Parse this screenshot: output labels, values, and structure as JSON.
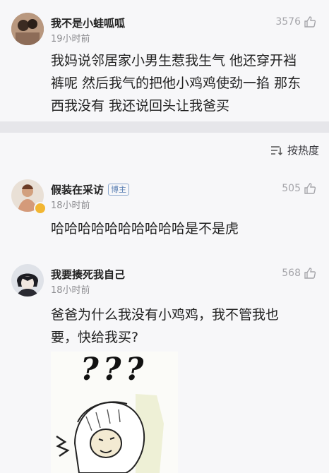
{
  "comments": [
    {
      "user": "我不是小蛙呱呱",
      "time": "19小时前",
      "likes": "3576",
      "text_lines": [
        "我妈说邻居家小男生惹我生气 他还穿开裆",
        "裤呢 然后我气的把他小鸡鸡使劲一掐 那东",
        "西我没有 我还说回头让我爸买"
      ]
    },
    {
      "user": "假装在采访",
      "badge": "博主",
      "time": "18小时前",
      "likes": "505",
      "text_lines": [
        "哈哈哈哈哈哈哈哈哈哈是不是虎"
      ]
    },
    {
      "user": "我要揍死我自己",
      "time": "18小时前",
      "likes": "568",
      "text_lines": [
        "爸爸为什么我没有小鸡鸡，我不管我也",
        "要，快给我买?"
      ],
      "meme_text": "???"
    }
  ],
  "sort": {
    "label": "按热度",
    "icon": "sort-icon"
  },
  "colors": {
    "background": "#f7f7f9",
    "divider": "#e6e6ea",
    "badge": "#5a7fb3"
  }
}
